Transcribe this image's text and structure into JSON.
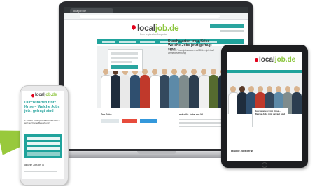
{
  "laptop_site": {
    "tab_title": "localjob.de",
    "logo_main": "local",
    "logo_accent": "job.de",
    "tagline": "Dein regionales Jobportal",
    "hero_headline": "Durchstarten trotz Krise – Welche Jobs jetzt gefragt sind",
    "hero_sub": "+ 55.000 Traumjobs warten auf Dich – jetzt auf Deine Bewerbung!",
    "section_left": "Top Jobs",
    "section_right": "aktuelle Jobs der W"
  },
  "tablet_site": {
    "logo_main": "local",
    "logo_accent": "job.de",
    "hero_headline": "Durchstarten trotz Krise – Welche Jobs jetzt gefragt sind",
    "section_title": "aktuelle Jobs der W"
  },
  "phone_site": {
    "logo_main": "local",
    "logo_accent": "job.de",
    "headline": "Durchstarten trotz Krise – Welche Jobs jetzt gefragt sind",
    "sub": "+ 55.000 Traumjobs warten auf Dich – jetzt auf Deine Bewerbung!",
    "section_title": "aktuelle Jobs der W"
  },
  "colors": {
    "brand_teal": "#20a39c",
    "brand_green": "#8dc63f",
    "pin_red": "#e2001a",
    "arrow_green": "#98c93c"
  }
}
